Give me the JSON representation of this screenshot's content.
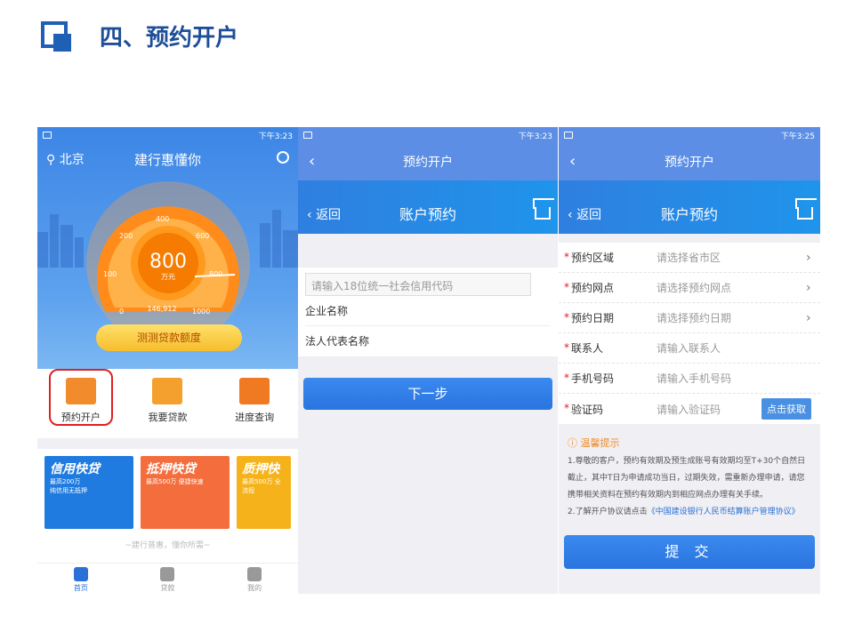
{
  "slide": {
    "title": "四、预约开户"
  },
  "status": {
    "time1": "下午3:23",
    "time2": "下午3:23",
    "time3": "下午3:25",
    "icons": "IDI ⁴ᴳ.ıll ⁴ᴳ.ıll ▭ ✔"
  },
  "home": {
    "location": "北京",
    "app_title": "建行惠懂你",
    "gauge": {
      "value": "800",
      "unit": "万元",
      "sub": "146,912",
      "ticks": [
        "0",
        "100",
        "200",
        "400",
        "600",
        "800",
        "1000"
      ]
    },
    "calc_button": "测测贷款额度",
    "menu": [
      {
        "label": "预约开户"
      },
      {
        "label": "我要贷款"
      },
      {
        "label": "进度查询"
      }
    ],
    "banners": [
      {
        "title": "信用快贷",
        "line1": "最高200万",
        "line2": "纯信用无抵押"
      },
      {
        "title": "抵押快贷",
        "line1": "最高500万 便捷快速",
        "line2": ""
      },
      {
        "title": "质押快",
        "line1": "最高500万 全流程",
        "line2": ""
      }
    ],
    "slogan": "~建行普惠，懂你所需~",
    "tabs": [
      {
        "label": "首页"
      },
      {
        "label": "贷款"
      },
      {
        "label": "我的"
      }
    ]
  },
  "p2": {
    "top_title": "预约开户",
    "back_label": "返回",
    "sub_title": "账户预约",
    "code_placeholder": "请输入18位统一社会信用代码",
    "row1": "企业名称",
    "row2": "法人代表名称",
    "next": "下一步"
  },
  "p3": {
    "top_title": "预约开户",
    "back_label": "返回",
    "sub_title": "账户预约",
    "rows": [
      {
        "label": "预约区域",
        "value": "请选择省市区"
      },
      {
        "label": "预约网点",
        "value": "请选择预约网点"
      },
      {
        "label": "预约日期",
        "value": "请选择预约日期"
      },
      {
        "label": "联系人",
        "value": "请输入联系人"
      },
      {
        "label": "手机号码",
        "value": "请输入手机号码"
      },
      {
        "label": "验证码",
        "value": "请输入验证码"
      }
    ],
    "get_code": "点击获取",
    "tips_title": "温馨提示",
    "tip1": "1.尊敬的客户，预约有效期及预生成账号有效期均至T+30个自然日截止，其中T日为申请成功当日，过期失效，需重新办理申请，请您携带相关资料在预约有效期内到相应网点办理有关手续。",
    "tip2_prefix": "2.了解开户协议请点击",
    "tip2_link": "《中国建设银行人民币结算账户管理协议》",
    "submit": "提 交"
  }
}
